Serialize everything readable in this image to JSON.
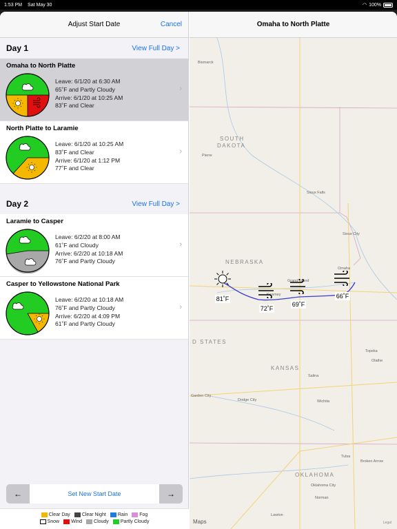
{
  "status": {
    "time": "1:53 PM",
    "date": "Sat May 30",
    "battery": "100%"
  },
  "left": {
    "title": "Adjust Start Date",
    "cancel": "Cancel",
    "days": [
      {
        "label": "Day 1",
        "link": "View Full Day >"
      },
      {
        "label": "Day 2",
        "link": "View Full Day >"
      }
    ],
    "legs": [
      {
        "title": "Omaha to North Platte",
        "leave": "Leave: 6/1/20 at 6:30 AM",
        "leave_wx": "65˚F and Partly Cloudy",
        "arrive": "Arrive: 6/1/20 at 10:25 AM",
        "arrive_wx": "83˚F and Clear"
      },
      {
        "title": "North Platte to Laramie",
        "leave": "Leave: 6/1/20 at 10:25 AM",
        "leave_wx": "83˚F and Clear",
        "arrive": "Arrive: 6/1/20 at 1:12 PM",
        "arrive_wx": "77˚F and Clear"
      },
      {
        "title": "Laramie to Casper",
        "leave": "Leave: 6/2/20 at 8:00 AM",
        "leave_wx": "61˚F and Cloudy",
        "arrive": "Arrive: 6/2/20 at 10:18 AM",
        "arrive_wx": "76˚F and Partly Cloudy"
      },
      {
        "title": "Casper to Yellowstone National Park",
        "leave": "Leave: 6/2/20 at 10:18 AM",
        "leave_wx": "76˚F and Partly Cloudy",
        "arrive": "Arrive: 6/2/20 at 4:09 PM",
        "arrive_wx": "61˚F and Partly Cloudy"
      }
    ],
    "prev_icon": "arrow-left-icon",
    "next_icon": "arrow-right-icon",
    "set_start": "Set New Start Date",
    "legend": [
      {
        "label": "Clear Day",
        "color": "#f5b800"
      },
      {
        "label": "Clear Night",
        "color": "#444444"
      },
      {
        "label": "Rain",
        "color": "#1e7be0"
      },
      {
        "label": "Fog",
        "color": "#d98cd9"
      },
      {
        "label": "Snow",
        "color": "#ffffff"
      },
      {
        "label": "Wind",
        "color": "#e01010"
      },
      {
        "label": "Cloudy",
        "color": "#a8a8a8"
      },
      {
        "label": "Partly Cloudy",
        "color": "#22cc22"
      }
    ]
  },
  "right": {
    "title": "Omaha to North Platte",
    "map_labels": {
      "bismarck": "Bismarck",
      "pierre": "Pierre",
      "south": "SOUTH",
      "dakota": "DAKOTA",
      "sioux_falls": "Sioux Falls",
      "sioux_city": "Sioux City",
      "nebraska": "NEBRASKA",
      "grand_island": "Grand Island",
      "kearney": "Kearney",
      "omaha": "Omaha",
      "united_states": "D STATES",
      "topeka": "Topeka",
      "olathe": "Olathe",
      "kansas": "KANSAS",
      "salina": "Salina",
      "garden_city": "Garden City",
      "dodge_city": "Dodge City",
      "wichita": "Wichita",
      "tulsa": "Tulsa",
      "broken_arrow": "Broken Arrow",
      "oklahoma": "OKLAHOMA",
      "oklahoma_city": "Oklahoma City",
      "norman": "Norman",
      "lawton": "Lawton"
    },
    "markers": [
      {
        "icon": "sun-icon",
        "temp": "81˚F"
      },
      {
        "icon": "wind-icon",
        "temp": "72˚F"
      },
      {
        "icon": "wind-icon",
        "temp": "69˚F"
      },
      {
        "icon": "wind-icon",
        "temp": "66˚F"
      }
    ],
    "maps_brand": "Maps",
    "legal": "Legal"
  }
}
